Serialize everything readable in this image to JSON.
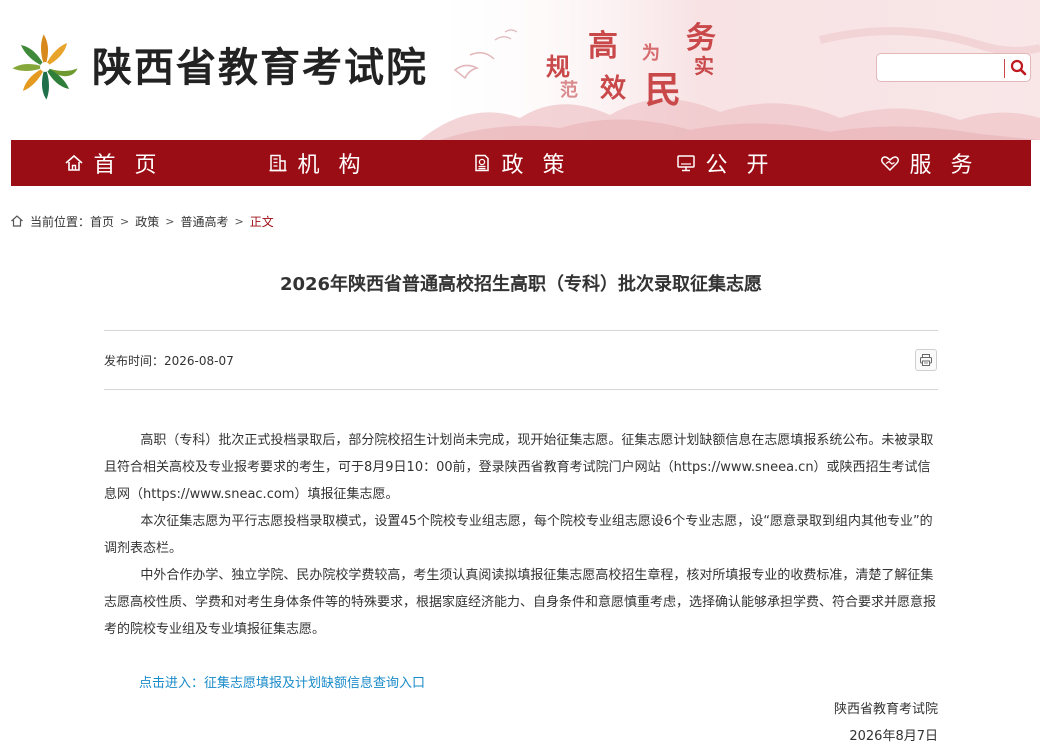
{
  "header": {
    "site_name": "陕西省教育考试院",
    "slogan": [
      "高",
      "规",
      "为",
      "务",
      "实",
      "范",
      "效",
      "民"
    ],
    "search_placeholder": ""
  },
  "nav": {
    "items": [
      {
        "label": "首 页",
        "icon": "home-icon"
      },
      {
        "label": "机 构",
        "icon": "building-icon"
      },
      {
        "label": "政 策",
        "icon": "policy-document-icon"
      },
      {
        "label": "公 开",
        "icon": "monitor-icon"
      },
      {
        "label": "服 务",
        "icon": "heart-hand-icon"
      }
    ]
  },
  "breadcrumb": {
    "prefix": "当前位置：",
    "items": [
      "首页",
      "政策",
      "普通高考"
    ],
    "current": "正文",
    "separator": ">"
  },
  "article": {
    "title": "2026年陕西省普通高校招生高职（专科）批次录取征集志愿",
    "publish_label": "发布时间：",
    "publish_date": "2026-08-07",
    "paragraphs": [
      "高职（专科）批次正式投档录取后，部分院校招生计划尚未完成，现开始征集志愿。征集志愿计划缺额信息在志愿填报系统公布。未被录取且符合相关高校及专业报考要求的考生，可于8月9日10：00前，登录陕西省教育考试院门户网站（https://www.sneea.cn）或陕西招生考试信息网（https://www.sneac.com）填报征集志愿。",
      "本次征集志愿为平行志愿投档录取模式，设置45个院校专业组志愿，每个院校专业组志愿设6个专业志愿，设“愿意录取到组内其他专业”的调剂表态栏。",
      "中外合作办学、独立学院、民办院校学费较高，考生须认真阅读拟填报征集志愿高校招生章程，核对所填报专业的收费标准，清楚了解征集志愿高校性质、学费和对考生身体条件等的特殊要求，根据家庭经济能力、自身条件和意愿慎重考虑，选择确认能够承担学费、符合要求并愿意报考的院校专业组及专业填报征集志愿。"
    ],
    "entry_link": "点击进入：征集志愿填报及计划缺额信息查询入口",
    "signature_org": "陕西省教育考试院",
    "signature_date": "2026年8月7日"
  },
  "colors": {
    "nav_bg": "#9b0d14",
    "accent": "#9b0d14",
    "link": "#1a8bc9",
    "slogan": "#c9484a"
  }
}
